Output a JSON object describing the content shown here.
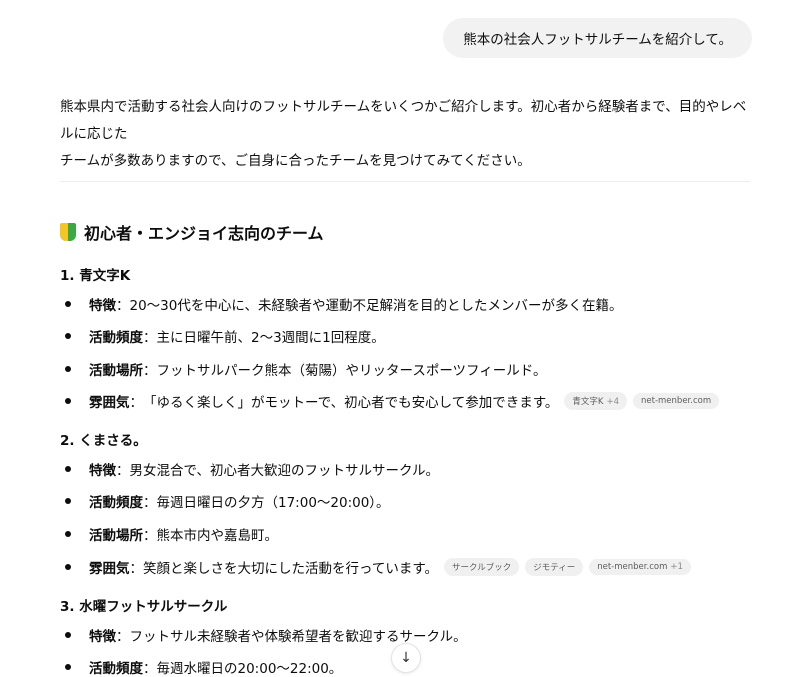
{
  "user_message": "熊本の社会人フットサルチームを紹介して。",
  "intro": {
    "line1": "熊本県内で活動する社会人向けのフットサルチームをいくつかご紹介します。初心者から経験者まで、目的やレベルに応じた",
    "line2": "チームが多数ありますので、ご自身に合ったチームを見つけてみてください。"
  },
  "section": {
    "title": "初心者・エンジョイ志向のチーム",
    "icon": "beginner-mark-icon"
  },
  "teams": [
    {
      "heading": "1. 青文字K",
      "items": [
        {
          "label": "特徴",
          "sep": "：",
          "text": "20〜30代を中心に、未経験者や運動不足解消を目的としたメンバーが多く在籍。"
        },
        {
          "label": "活動頻度",
          "sep": "：",
          "text": "主に日曜午前、2〜3週間に1回程度。"
        },
        {
          "label": "活動場所",
          "sep": "：",
          "text": "フットサルパーク熊本（菊陽）やリッタースポーツフィールド。"
        },
        {
          "label": "雰囲気",
          "sep": "：",
          "text": "「ゆるく楽しく」がモットーで、初心者でも安心して参加できます。"
        }
      ],
      "sources": [
        {
          "label": "青文字K",
          "count": "+4"
        },
        {
          "label": "net-menber.com",
          "count": ""
        }
      ]
    },
    {
      "heading": "2. くまさる。",
      "items": [
        {
          "label": "特徴",
          "sep": "：",
          "text": "男女混合で、初心者大歓迎のフットサルサークル。"
        },
        {
          "label": "活動頻度",
          "sep": "：",
          "text": "毎週日曜日の夕方（17:00〜20:00）。"
        },
        {
          "label": "活動場所",
          "sep": "：",
          "text": "熊本市内や嘉島町。"
        },
        {
          "label": "雰囲気",
          "sep": "：",
          "text": "笑顔と楽しさを大切にした活動を行っています。"
        }
      ],
      "sources": [
        {
          "label": "サークルブック",
          "count": ""
        },
        {
          "label": "ジモティー",
          "count": ""
        },
        {
          "label": "net-menber.com",
          "count": "+1"
        }
      ]
    },
    {
      "heading": "3. 水曜フットサルサークル",
      "items": [
        {
          "label": "特徴",
          "sep": "：",
          "text": "フットサル未経験者や体験希望者を歓迎するサークル。"
        },
        {
          "label": "活動頻度",
          "sep": "：",
          "text": "毎週水曜日の20:00〜22:00。"
        }
      ]
    }
  ],
  "scroll_button": {
    "glyph": "↓"
  }
}
